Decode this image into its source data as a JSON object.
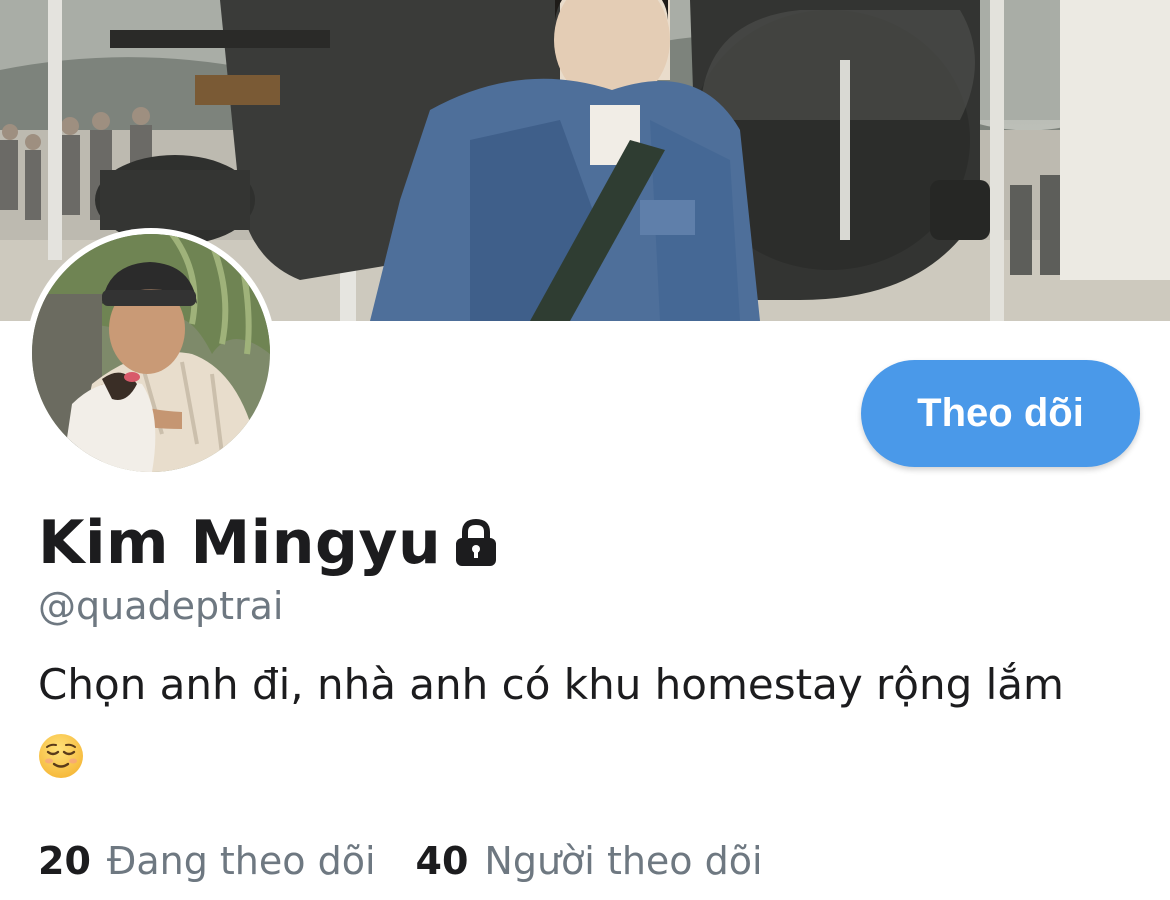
{
  "profile": {
    "display_name": "Kim Mingyu",
    "handle": "@quadeptrai",
    "bio": "Chọn anh đi, nhà anh có khu homestay rộng lắm",
    "bio_emoji": "relieved-face-emoji",
    "locked_icon": "lock-icon",
    "follow_button_label": "Theo dõi",
    "following_count": "20",
    "following_label": "Đang theo dõi",
    "followers_count": "40",
    "followers_label": "Người theo dõi"
  },
  "colors": {
    "accent": "#4a99e9",
    "text_primary": "#1c1c1e",
    "text_secondary": "#6e7881",
    "background": "#ffffff"
  }
}
